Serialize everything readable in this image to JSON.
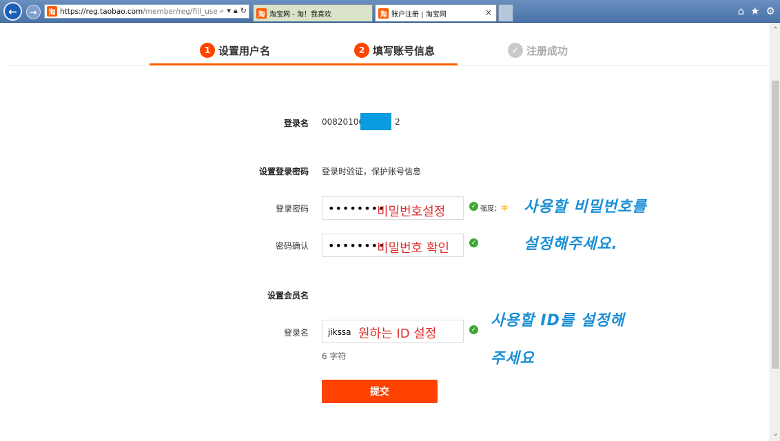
{
  "browser": {
    "url_host": "https://reg.taobao.com",
    "url_path": "/member/reg/fill_user",
    "favicon_glyph": "淘",
    "tabs": [
      {
        "label": "淘宝网 - 淘！我喜欢"
      },
      {
        "label": "账户注册 | 淘宝网",
        "close": "×"
      }
    ]
  },
  "steps": [
    {
      "num": "1",
      "label": "设置用户名"
    },
    {
      "num": "2",
      "label": "填写账号信息"
    },
    {
      "num": "✓",
      "label": "注册成功"
    }
  ],
  "form": {
    "login_name_label": "登录名",
    "login_name_prefix": "00820106",
    "login_name_suffix": "2",
    "password_section_label": "设置登录密码",
    "password_section_hint": "登录时验证，保护账号信息",
    "password_label": "登录密码",
    "password_value": "••••••••",
    "strength_label": "强度：",
    "strength_value": "中",
    "confirm_label": "密码确认",
    "confirm_value": "••••••••",
    "member_section_label": "设置会员名",
    "member_label": "登录名",
    "member_value": "jikssa",
    "member_hint": "6 字符",
    "submit_label": "提交"
  },
  "annotations": {
    "password_overlay": "비밀번호설정",
    "confirm_overlay": "비밀번호 확인",
    "id_overlay": "원하는 ID 설정",
    "note_password_line1": "사용할 비밀번호를",
    "note_password_line2": "설정해주세요.",
    "note_id_line1": "사용할 ID를 설정해",
    "note_id_line2": "주세요"
  },
  "colors": {
    "accent": "#ff4400",
    "ok": "#3fa832",
    "annotation_red": "#e03030",
    "annotation_blue": "#1a8fd6"
  }
}
